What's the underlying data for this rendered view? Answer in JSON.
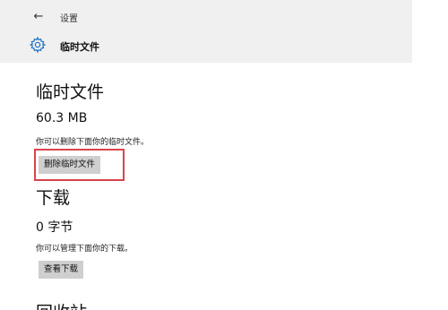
{
  "header": {
    "back_glyph": "←",
    "title": "设置",
    "page_title": "临时文件",
    "page_icon": "gear-icon"
  },
  "temp_files": {
    "heading": "临时文件",
    "size": "60.3 MB",
    "description": "你可以删除下面你的临时文件。",
    "button_label": "删除临时文件"
  },
  "downloads": {
    "heading": "下载",
    "size": "0 字节",
    "description": "你可以管理下面你的下载。",
    "button_label": "查看下载"
  },
  "next_section": {
    "heading": "回收站"
  },
  "colors": {
    "header_bg": "#f0f0f0",
    "button_bg": "#cfcfcf",
    "highlight": "#d9444b",
    "icon_blue": "#1a6fc2"
  }
}
